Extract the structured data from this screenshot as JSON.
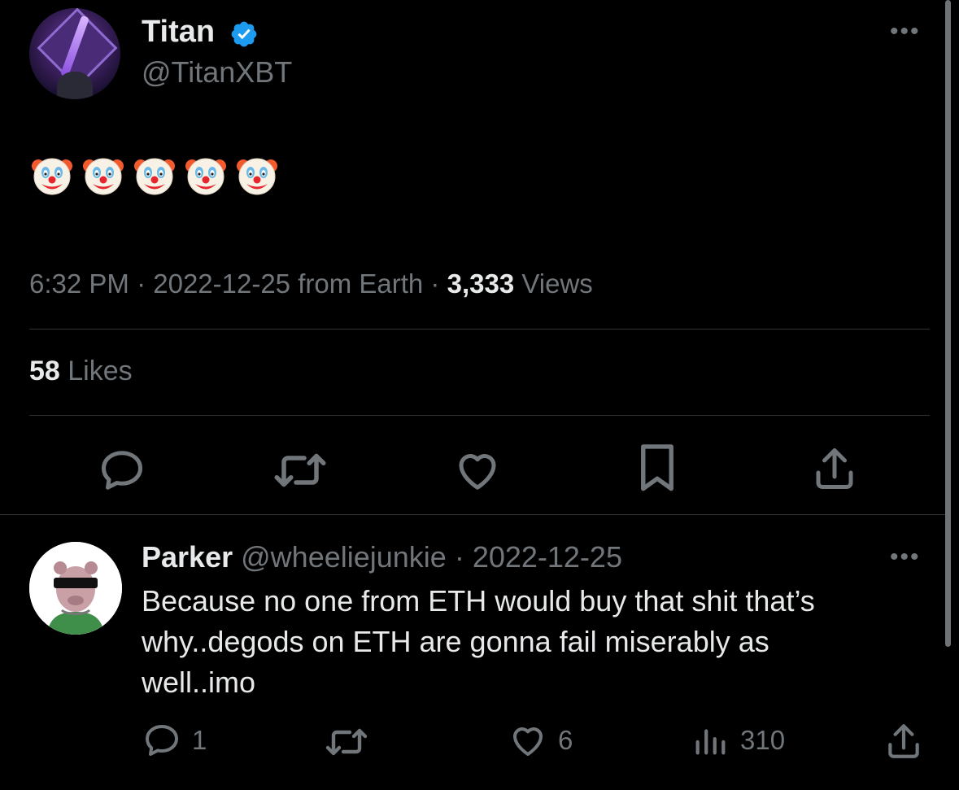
{
  "tweet": {
    "author_name": "Titan",
    "author_handle": "@TitanXBT",
    "more_label": "•••",
    "emoji_text": "🤡🤡🤡🤡🤡",
    "emoji_count": 5,
    "time": "6:32 PM",
    "sep1": " · ",
    "date": "2022-12-25",
    "source": " from Earth",
    "sep2": " · ",
    "views_count": "3,333",
    "views_label": " Views",
    "likes_count": "58",
    "likes_label": " Likes"
  },
  "actions": {
    "icons": [
      "reply-icon",
      "retweet-icon",
      "like-icon",
      "bookmark-icon",
      "share-icon"
    ]
  },
  "reply": {
    "author_name": "Parker",
    "author_handle": "@wheeliejunkie",
    "sep": " · ",
    "date": "2022-12-25",
    "more_label": "•••",
    "text_lines": [
      "Because no one from ETH would buy that shit that’s",
      "why..degods on ETH are gonna fail miserably as",
      "well..imo"
    ],
    "reply_count": "1",
    "like_count": "6",
    "view_count": "310"
  },
  "colors": {
    "background": "#000000",
    "text": "#e7e9ea",
    "secondary": "#71767b",
    "verified": "#1d9bf0",
    "divider": "#2f3336"
  }
}
